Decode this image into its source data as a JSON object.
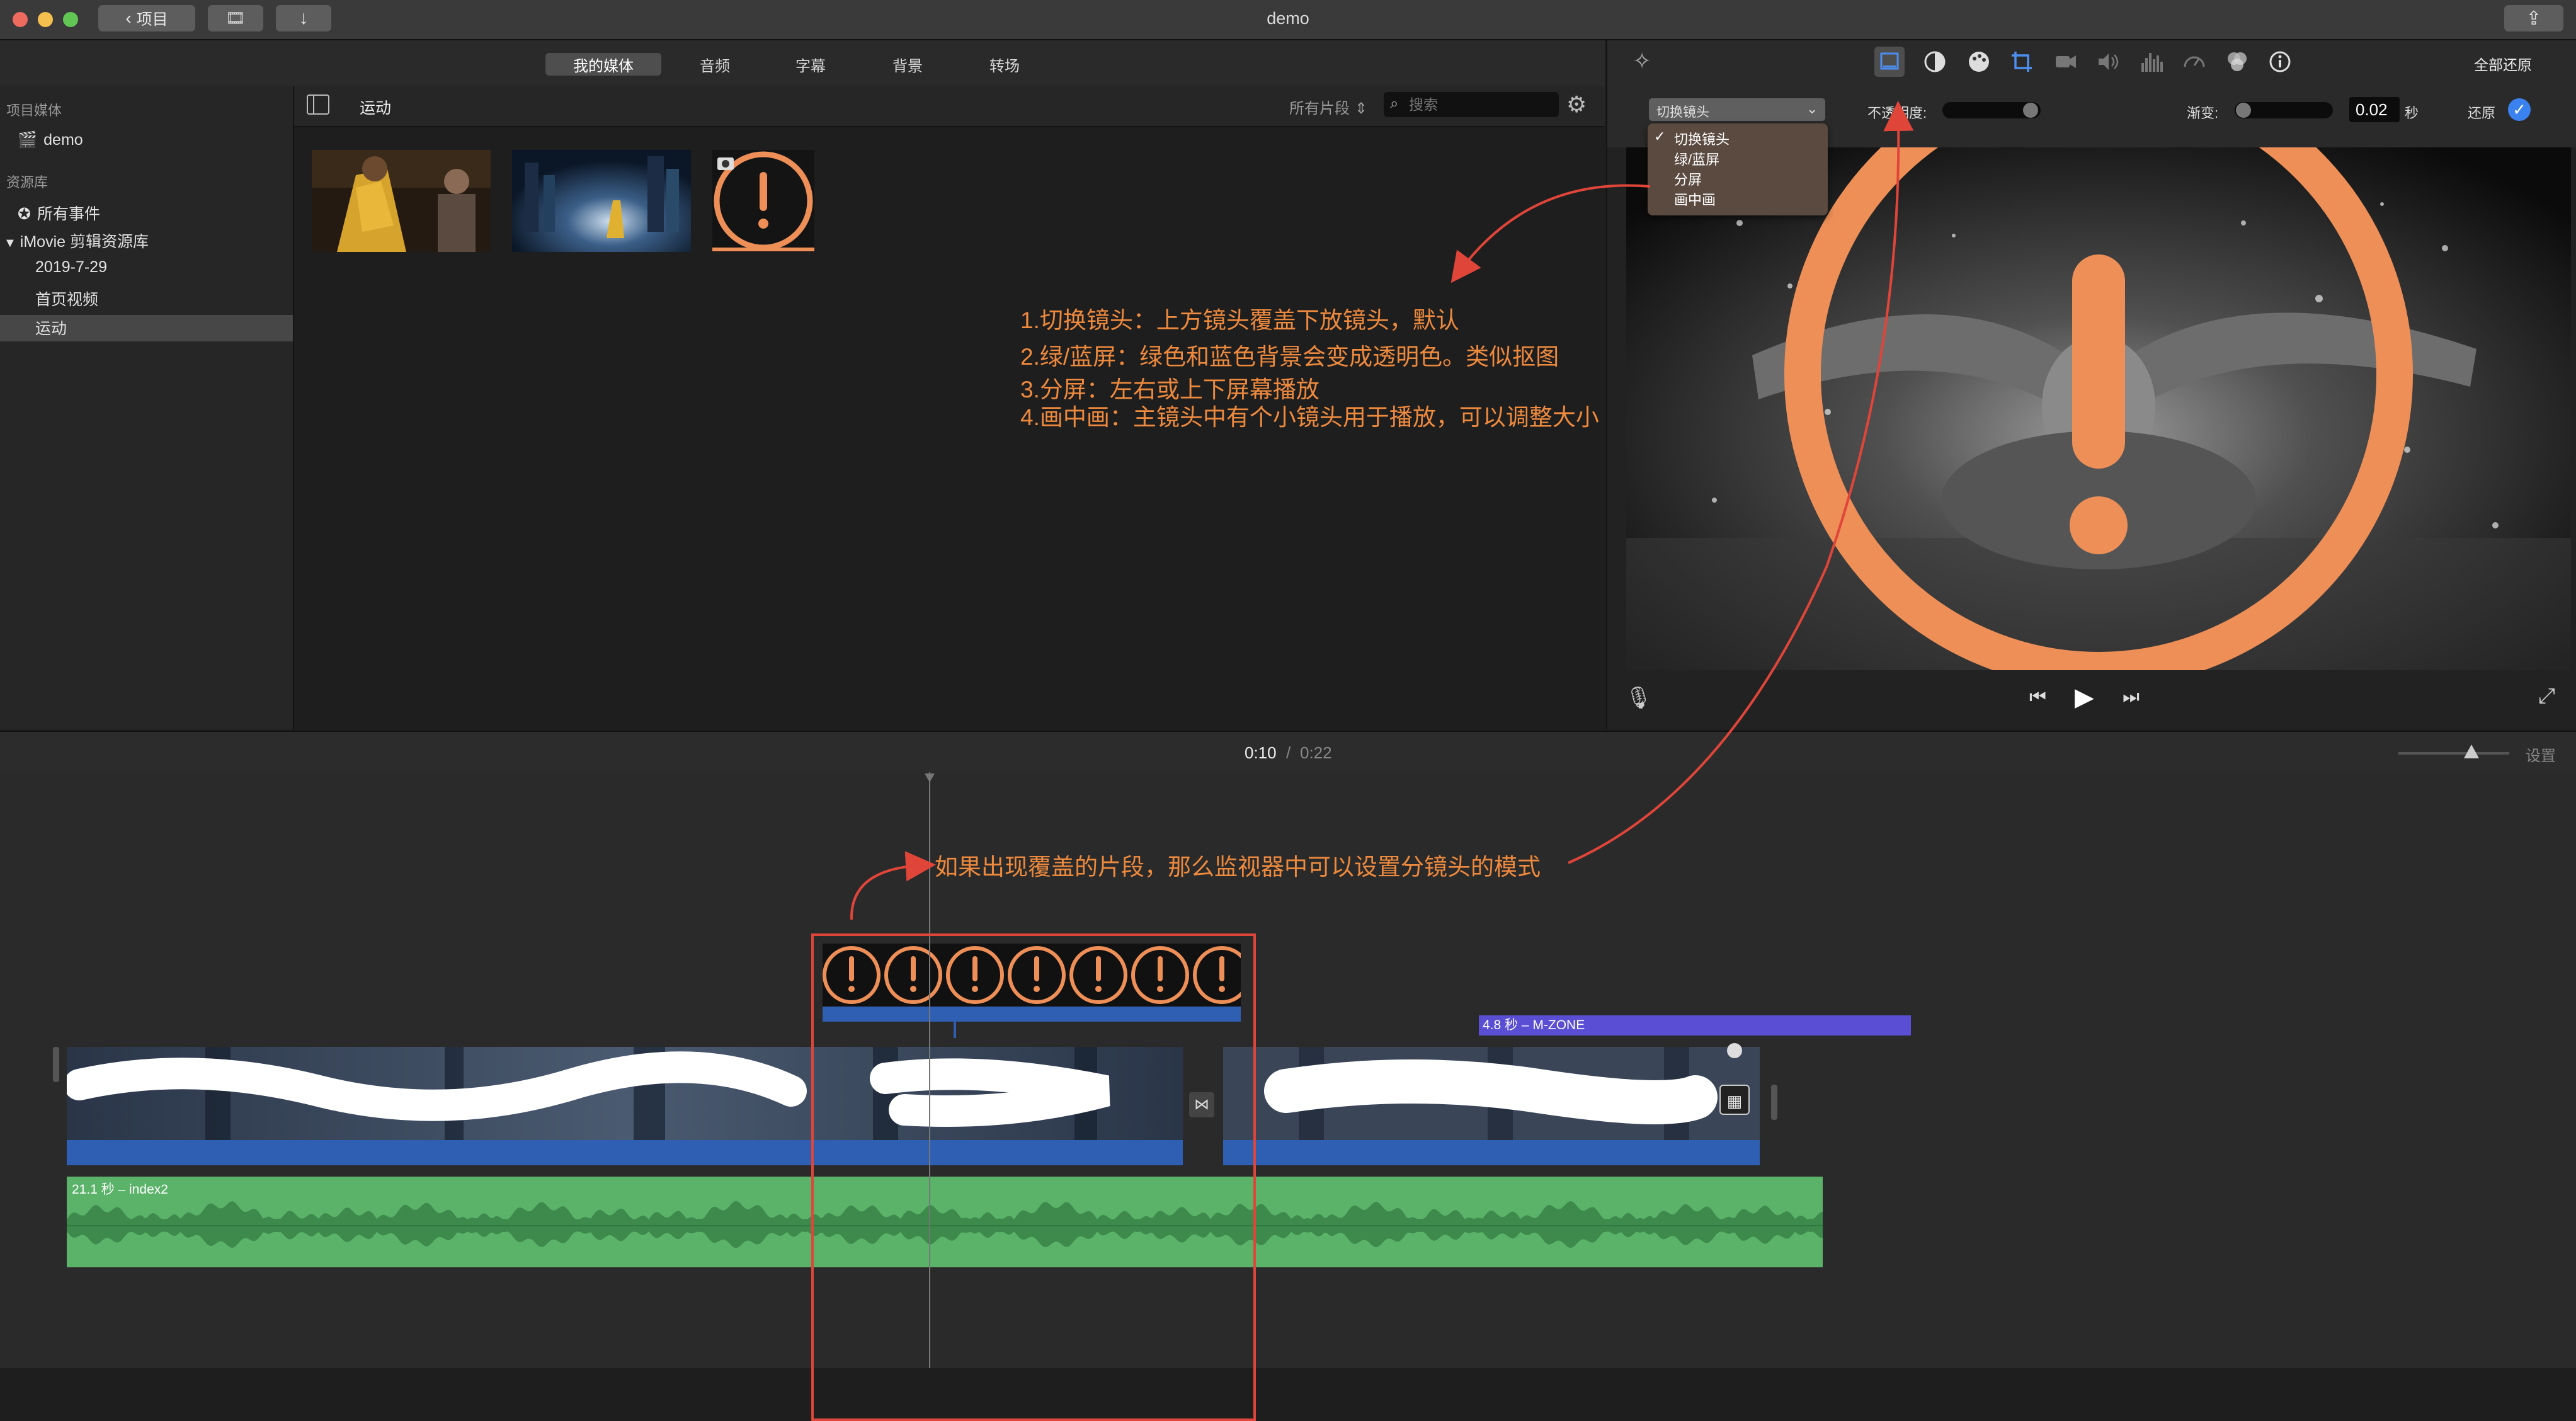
{
  "window": {
    "title": "demo",
    "back_button_label": "项目",
    "traffic_lights": [
      "#ed6a5e",
      "#f5bf4f",
      "#62c655"
    ]
  },
  "toolbar": {
    "tabs": [
      "我的媒体",
      "音频",
      "字幕",
      "背景",
      "转场"
    ],
    "selected_tab": "我的媒体",
    "reset_all_label": "全部还原"
  },
  "sidebar": {
    "section_project_media": "项目媒体",
    "project_name": "demo",
    "section_library": "资源库",
    "all_events": "所有事件",
    "library_name": "iMovie 剪辑资源库",
    "events": [
      "2019-7-29",
      "首页视频",
      "运动"
    ],
    "selected_event": "运动"
  },
  "browser": {
    "event_title": "运动",
    "filter_label": "所有片段",
    "search_placeholder": "搜索",
    "thumbnails": [
      "dancer-clip",
      "city-night-clip",
      "warning-image"
    ]
  },
  "inspector": {
    "overlay_mode_selected": "切换镜头",
    "overlay_mode_options": [
      "切换镜头",
      "绿/蓝屏",
      "分屏",
      "画中画"
    ],
    "opacity_label": "不透明度:",
    "fade_label": "渐变:",
    "fade_value": "0.02",
    "fade_unit": "秒",
    "reset_label": "还原"
  },
  "playback": {
    "current_time": "0:10",
    "separator": "/",
    "total_time": "0:22",
    "settings_label": "设置"
  },
  "annotations": {
    "lines": [
      "1.切换镜头：上方镜头覆盖下放镜头，默认",
      "2.绿/蓝屏：绿色和蓝色背景会变成透明色。类似抠图",
      "3.分屏：左右或上下屏幕播放",
      "4.画中画：主镜头中有个小镜头用于播放，可以调整大小"
    ],
    "timeline_note": "如果出现覆盖的片段，那么监视器中可以设置分镜头的模式",
    "color": "#ee8a3e"
  },
  "timeline": {
    "title_clip_label": "4.8 秒 – M-ZONE",
    "audio_clip_label": "21.1 秒 – index2"
  },
  "colors": {
    "accent_blue": "#2f5fb3",
    "audio_green": "#5bb36a",
    "title_purple": "#5a4fd4",
    "warning_orange": "#ee8f58"
  }
}
